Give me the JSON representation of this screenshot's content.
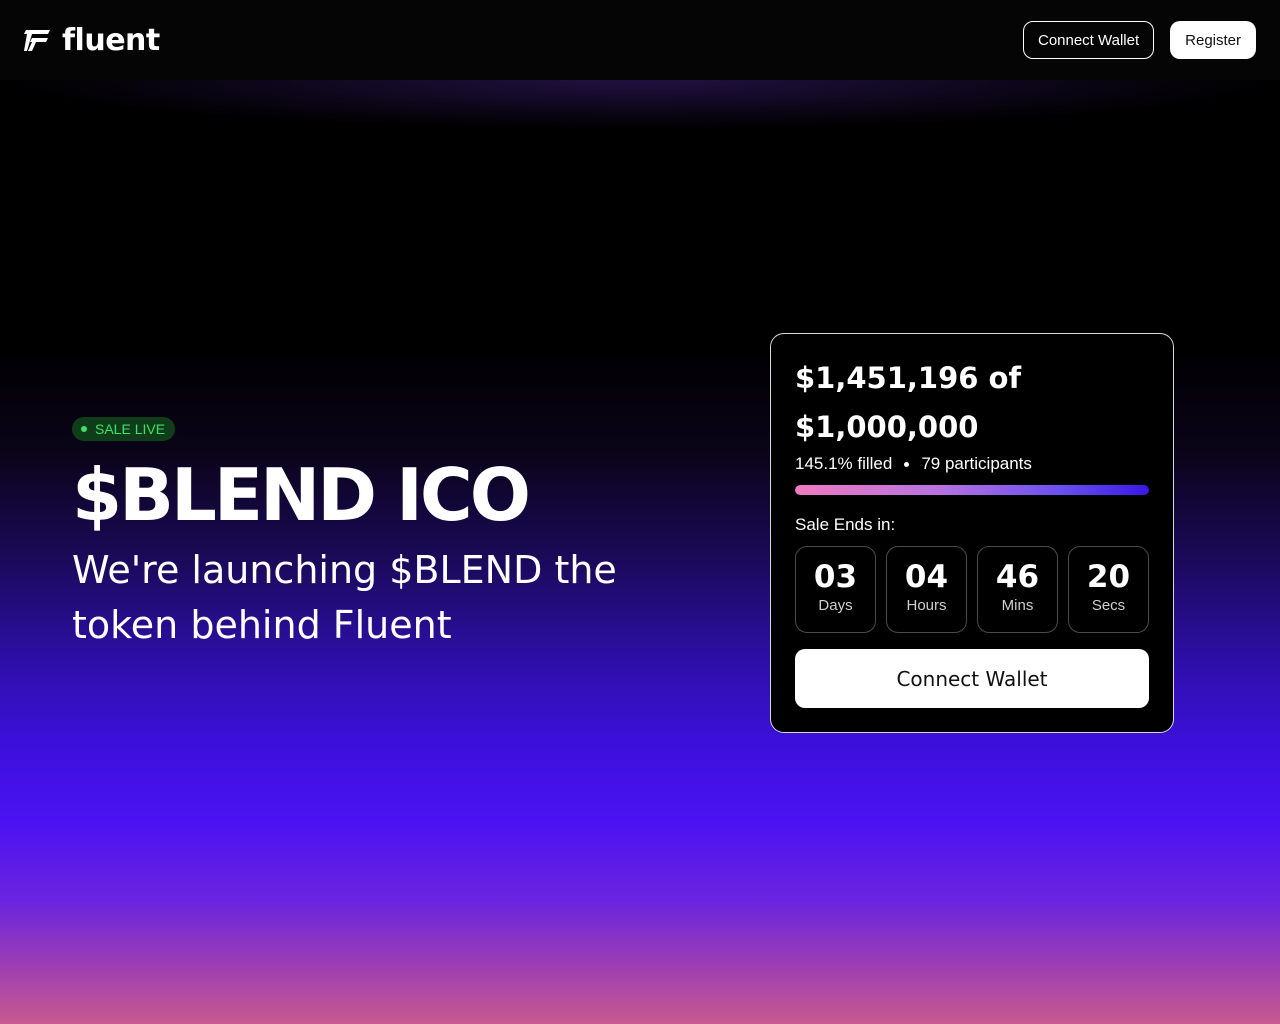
{
  "brand": {
    "name": "fluent",
    "logo_icon": "fluent-logo-icon"
  },
  "nav": {
    "connect_wallet_label": "Connect Wallet",
    "register_label": "Register"
  },
  "hero": {
    "badge": "SALE LIVE",
    "title": "$BLEND ICO",
    "subtitle": "We're launching $BLEND the token behind Fluent"
  },
  "sale_card": {
    "raised": "$1,451,196 of",
    "goal": "$1,000,000",
    "filled_label": "145.1% filled",
    "participants_label": "79 participants",
    "progress_fraction": 1.0,
    "ends_label": "Sale Ends in:",
    "countdown": [
      {
        "value": "03",
        "unit": "Days"
      },
      {
        "value": "04",
        "unit": "Hours"
      },
      {
        "value": "46",
        "unit": "Mins"
      },
      {
        "value": "20",
        "unit": "Secs"
      }
    ],
    "cta_label": "Connect Wallet"
  },
  "colors": {
    "badge_text": "#3ee06a",
    "badge_bg": "#0f3d1a",
    "progress_start": "#f07ac0",
    "progress_end": "#3b16e6",
    "gradient_purple": "#4a12f2",
    "gradient_pink": "#c85a90"
  }
}
